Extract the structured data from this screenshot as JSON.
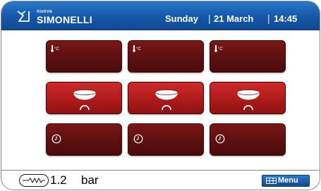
{
  "header": {
    "brand_prefix": "nuova",
    "brand_name": "SIMONELLI",
    "day": "Sunday",
    "date": "21 March",
    "time": "14:45",
    "separator": "|",
    "background": "#1657a8"
  },
  "tiles": {
    "temperature_label": "°C",
    "temperature_icon": "thermometer-icon",
    "brew_icon": "coffee-cup-icon",
    "timer_icon": "clock-icon",
    "colors": {
      "dark": "#5e1010",
      "active": "#b21c1c"
    }
  },
  "footer": {
    "pressure_icon": "pump-wave-icon",
    "pressure_value": "1.2",
    "pressure_unit": "bar",
    "menu_icon": "grid-icon",
    "menu_label": "Menu"
  }
}
